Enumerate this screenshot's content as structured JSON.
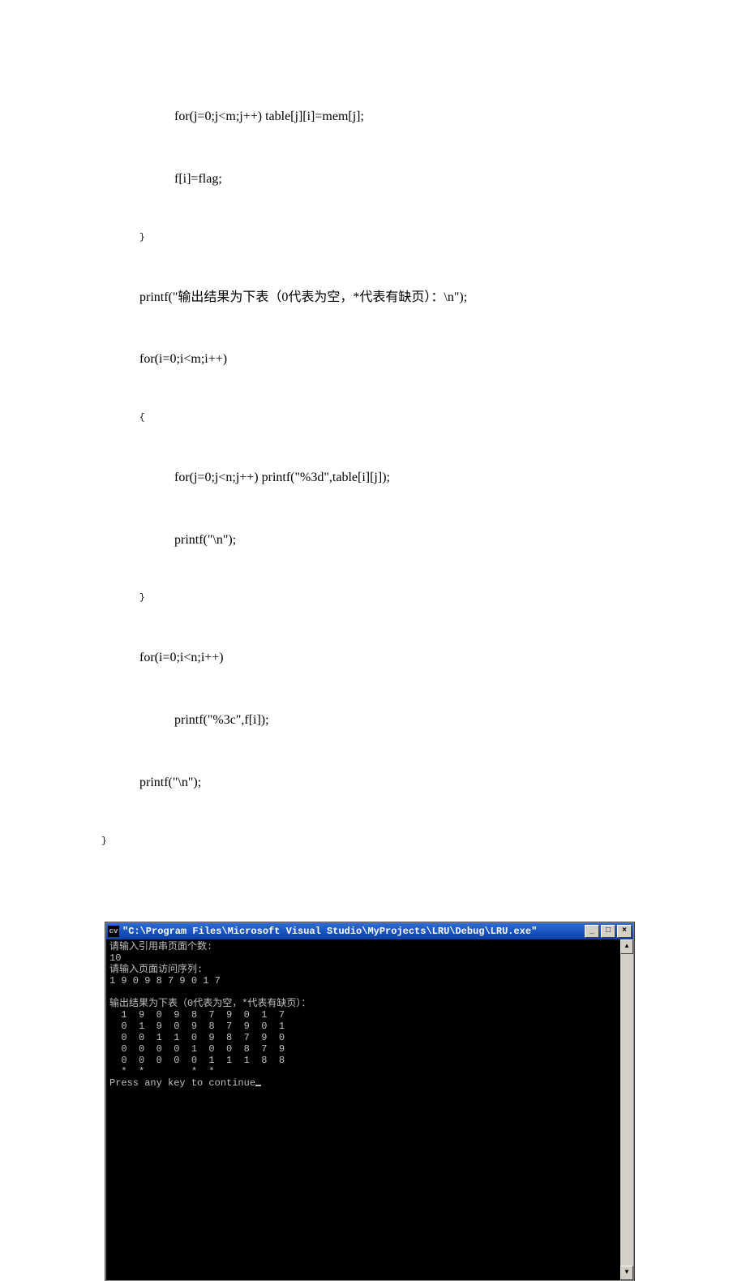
{
  "code": {
    "l1": "for(j=0;j<m;j++) table[j][i]=mem[j];",
    "l2": "f[i]=flag;",
    "l3": "}",
    "l4": "printf(\"输出结果为下表（0代表为空，*代表有缺页）：\\n\");",
    "l5": "for(i=0;i<m;i++)",
    "l6": "{",
    "l7": "for(j=0;j<n;j++) printf(\"%3d\",table[i][j]);",
    "l8": "printf(\"\\n\");",
    "l9": "}",
    "l10": "for(i=0;i<n;i++)",
    "l11": "printf(\"%3c\",f[i]);",
    "l12": "printf(\"\\n\");",
    "l13": "}"
  },
  "console": {
    "title_prefix": "cv",
    "title": "\"C:\\Program Files\\Microsoft Visual Studio\\MyProjects\\LRU\\Debug\\LRU.exe\"",
    "prompt1": "请输入引用串页面个数:",
    "n_value": "10",
    "prompt2": "请输入页面访问序列:",
    "sequence": "1 9 0 9 8 7 9 0 1 7",
    "blank": "",
    "result_header": "输出结果为下表（0代表为空，*代表有缺页）：",
    "rows": [
      "  1  9  0  9  8  7  9  0  1  7",
      "  0  1  9  0  9  8  7  9  0  1",
      "  0  0  1  1  0  9  8  7  9  0",
      "  0  0  0  0  1  0  0  8  7  9",
      "  0  0  0  0  0  1  1  1  8  8"
    ],
    "flags": "  *  *        *  *",
    "continue": "Press any key to continue"
  },
  "win": {
    "min": "_",
    "max": "□",
    "close": "×",
    "up": "▲",
    "down": "▼"
  }
}
